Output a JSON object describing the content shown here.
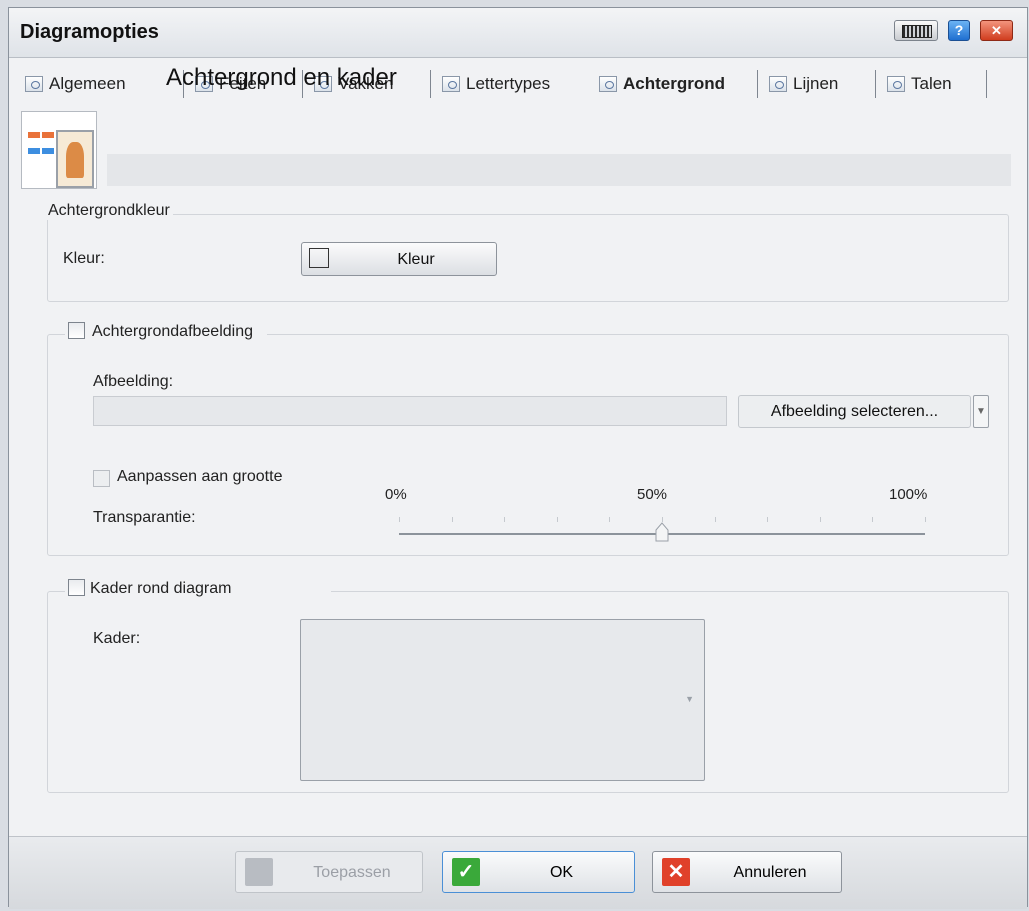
{
  "window": {
    "title": "Diagramopties"
  },
  "titlebar": {
    "help_label": "?",
    "close_label": "✕"
  },
  "tabs": [
    {
      "label": "Algemeen"
    },
    {
      "label": "Feiten"
    },
    {
      "label": "Vakken"
    },
    {
      "label": "Lettertypes"
    },
    {
      "label": "Achtergrond"
    },
    {
      "label": "Lijnen"
    },
    {
      "label": "Talen"
    }
  ],
  "header": {
    "title": "Achtergrond en kader"
  },
  "background_color": {
    "group_label": "Achtergrondkleur",
    "color_label": "Kleur:",
    "color_button_label": "Kleur",
    "color_value": "#ffffff"
  },
  "background_image": {
    "checkbox_label": "Achtergrondafbeelding",
    "checked": false,
    "image_label": "Afbeelding:",
    "image_value": "",
    "select_button_label": "Afbeelding selecteren...",
    "fit_label": "Aanpassen aan grootte",
    "transparency_label": "Transparantie:",
    "transparency_ticks": [
      "0%",
      "50%",
      "100%"
    ],
    "transparency_value": 50
  },
  "frame": {
    "checkbox_label": "Kader rond diagram",
    "checked": false,
    "frame_label": "Kader:"
  },
  "footer": {
    "apply_label": "Toepassen",
    "ok_label": "OK",
    "cancel_label": "Annuleren"
  },
  "colors": {
    "ok_green": "#3aa93a",
    "cancel_red": "#e0412a",
    "help_blue": "#2c7fd8"
  }
}
